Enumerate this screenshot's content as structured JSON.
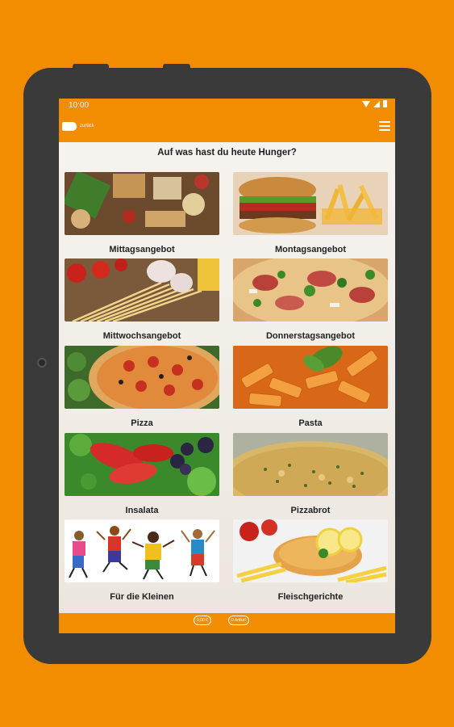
{
  "status": {
    "time": "10:00"
  },
  "appbar": {
    "back_label": "zurück"
  },
  "headline": "Auf was hast du heute Hunger?",
  "tiles": [
    {
      "label": "Mittagsangebot"
    },
    {
      "label": "Montagsangebot"
    },
    {
      "label": "Mittwochsangebot"
    },
    {
      "label": "Donnerstagsangebot"
    },
    {
      "label": "Pizza"
    },
    {
      "label": "Pasta"
    },
    {
      "label": "Insalata"
    },
    {
      "label": "Pizzabrot"
    },
    {
      "label": "Für die Kleinen"
    },
    {
      "label": "Fleischgerichte"
    }
  ],
  "footer": {
    "chip_price": "0,00 €",
    "chip_cart": "0 Artikel"
  },
  "colors": {
    "accent": "#f28c00",
    "bezel": "#3a3a3a"
  }
}
